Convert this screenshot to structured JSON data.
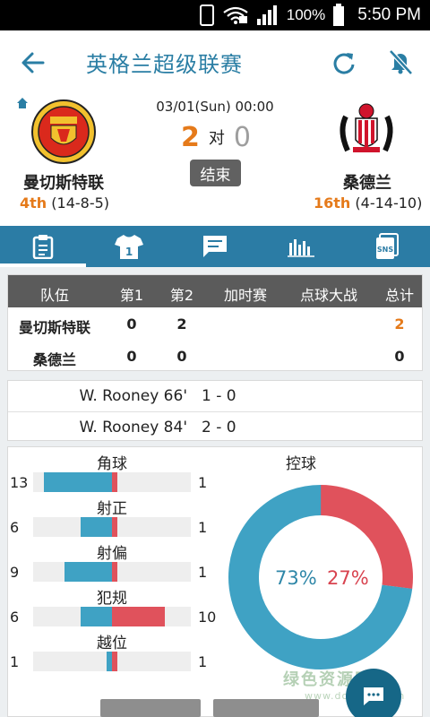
{
  "status_bar": {
    "battery": "100%",
    "time": "5:50 PM"
  },
  "app_bar": {
    "title": "英格兰超级联赛"
  },
  "match": {
    "datetime": "03/01(Sun) 00:00",
    "home": {
      "name": "曼切斯特联",
      "rank": "4th",
      "record": "(14-8-5)",
      "score": "2"
    },
    "away": {
      "name": "桑德兰",
      "rank": "16th",
      "record": "(4-14-10)",
      "score": "0"
    },
    "vs": "对",
    "status": "结束"
  },
  "tabs": [
    {
      "icon": "clipboard-icon"
    },
    {
      "icon": "jersey-icon",
      "number": "1"
    },
    {
      "icon": "chat-icon"
    },
    {
      "icon": "bar-chart-icon"
    },
    {
      "icon": "sns-icon",
      "label": "SNS"
    }
  ],
  "score_table": {
    "headers": [
      "队伍",
      "第1",
      "第2",
      "加时赛",
      "点球大战",
      "总计"
    ],
    "rows": [
      {
        "team": "曼切斯特联",
        "h1": "0",
        "h2": "2",
        "et": "",
        "pen": "",
        "total": "2"
      },
      {
        "team": "桑德兰",
        "h1": "0",
        "h2": "0",
        "et": "",
        "pen": "",
        "total": "0"
      }
    ]
  },
  "goals": [
    {
      "scorer": "W. Rooney 66'",
      "score": "1 - 0"
    },
    {
      "scorer": "W. Rooney 84'",
      "score": "2 - 0"
    }
  ],
  "stats": [
    {
      "label": "角球",
      "home": 13,
      "away": 1,
      "home_text": "13",
      "away_text": "1"
    },
    {
      "label": "射正",
      "home": 6,
      "away": 1,
      "home_text": "6",
      "away_text": "1"
    },
    {
      "label": "射偏",
      "home": 9,
      "away": 1,
      "home_text": "9",
      "away_text": "1"
    },
    {
      "label": "犯规",
      "home": 6,
      "away": 10,
      "home_text": "6",
      "away_text": "10"
    },
    {
      "label": "越位",
      "home": 1,
      "away": 1,
      "home_text": "1",
      "away_text": "1"
    }
  ],
  "possession": {
    "title": "控球",
    "home_pct": 73,
    "away_pct": 27,
    "home_text": "73%",
    "away_text": "27%"
  },
  "watermark": {
    "line1": "绿色资源网",
    "line2": "www.downcc.com"
  },
  "colors": {
    "primary": "#2b7ca5",
    "home": "#3fa2c4",
    "away": "#e0525c",
    "accent": "#e57a1a"
  }
}
